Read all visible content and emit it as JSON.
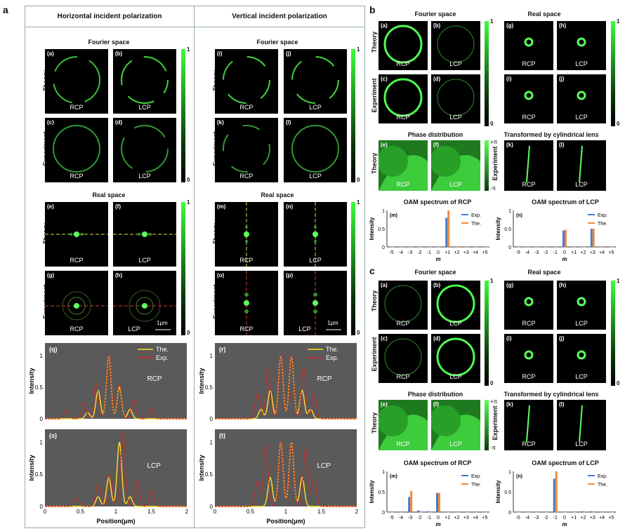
{
  "panel_letters": {
    "a": "a",
    "b": "b",
    "c": "c"
  },
  "a": {
    "left_header": "Horizontal incident polarization",
    "right_header": "Vertical incident polarization",
    "fourier": "Fourier space",
    "real": "Real space",
    "theory": "Theory",
    "experiment": "Experiment",
    "cbar_top": "1",
    "cbar_bot": "0",
    "scale": "1μm",
    "tiles_left": [
      {
        "t": "(a)",
        "b": "RCP"
      },
      {
        "t": "(b)",
        "b": "LCP"
      },
      {
        "t": "(c)",
        "b": "RCP"
      },
      {
        "t": "(d)",
        "b": "LCP"
      },
      {
        "t": "(e)",
        "b": "RCP"
      },
      {
        "t": "(f)",
        "b": "LCP"
      },
      {
        "t": "(g)",
        "b": "RCP"
      },
      {
        "t": "(h)",
        "b": "LCP"
      }
    ],
    "tiles_right": [
      {
        "t": "(i)",
        "b": "RCP"
      },
      {
        "t": "(j)",
        "b": "LCP"
      },
      {
        "t": "(k)",
        "b": "RCP"
      },
      {
        "t": "(l)",
        "b": "LCP"
      },
      {
        "t": "(m)",
        "b": "RCP"
      },
      {
        "t": "(n)",
        "b": "LCP"
      },
      {
        "t": "(o)",
        "b": "RCP"
      },
      {
        "t": "(p)",
        "b": "LCP"
      }
    ],
    "xlabel": "Position(μm)",
    "ylabel": "Intensity",
    "legend_the": "The.",
    "legend_exp": "Exp."
  },
  "b": {
    "fourier": "Fourier space",
    "real": "Real space",
    "phase": "Phase distribution",
    "transformed": "Transformed  by cylindrical lens",
    "theory": "Theory",
    "experiment": "Experiment",
    "tiles": [
      {
        "t": "(a)",
        "b": "RCP"
      },
      {
        "t": "(b)",
        "b": "LCP"
      },
      {
        "t": "(g)",
        "b": "RCP"
      },
      {
        "t": "(h)",
        "b": "LCP"
      },
      {
        "t": "(c)",
        "b": "RCP"
      },
      {
        "t": "(d)",
        "b": "LCP"
      },
      {
        "t": "(i)",
        "b": "RCP"
      },
      {
        "t": "(j)",
        "b": "LCP"
      },
      {
        "t": "(e)",
        "b": "RCP"
      },
      {
        "t": "(f)",
        "b": "LCP"
      },
      {
        "t": "(k)",
        "b": "RCP"
      },
      {
        "t": "(l)",
        "b": "LCP"
      }
    ],
    "pi_top": "+π",
    "pi_bot": "-π",
    "oam_rcp": "OAM spectrum of RCP",
    "oam_lcp": "OAM spectrum of LCP",
    "m_label": "m"
  },
  "c": {
    "fourier": "Fourier space",
    "real": "Real space",
    "phase": "Phase distribution",
    "transformed": "Transformed  by cylindrical lens",
    "theory": "Theory",
    "experiment": "Experiment",
    "tiles": [
      {
        "t": "(a)",
        "b": "RCP"
      },
      {
        "t": "(b)",
        "b": "LCP"
      },
      {
        "t": "(g)",
        "b": "RCP"
      },
      {
        "t": "(h)",
        "b": "LCP"
      },
      {
        "t": "(c)",
        "b": "RCP"
      },
      {
        "t": "(d)",
        "b": "LCP"
      },
      {
        "t": "(i)",
        "b": "RCP"
      },
      {
        "t": "(j)",
        "b": "LCP"
      },
      {
        "t": "(e)",
        "b": "RCP"
      },
      {
        "t": "(f)",
        "b": "LCP"
      },
      {
        "t": "(k)",
        "b": "RCP"
      },
      {
        "t": "(l)",
        "b": "LCP"
      }
    ],
    "oam_rcp": "OAM spectrum of RCP",
    "oam_lcp": "OAM spectrum of LCP"
  },
  "chart_data": [
    {
      "type": "line",
      "id": "q",
      "label": "(q)",
      "annotation": "RCP",
      "xlim": [
        0,
        2
      ],
      "ylim": [
        0,
        1.2
      ],
      "xticks": [
        "0",
        "0.5",
        "1",
        "1.5",
        "2"
      ],
      "yticks": [
        "0",
        "0.5",
        "1"
      ],
      "series": [
        {
          "name": "The.",
          "color": "#ffe02a",
          "peaks": [
            [
              0.9,
              1.0
            ],
            [
              1.05,
              0.5
            ],
            [
              0.75,
              0.45
            ],
            [
              1.2,
              0.15
            ],
            [
              0.6,
              0.1
            ]
          ]
        },
        {
          "name": "Exp.",
          "color": "#d42a2a",
          "peaks": [
            [
              0.9,
              1.0
            ],
            [
              1.05,
              0.55
            ],
            [
              0.72,
              0.55
            ],
            [
              1.25,
              0.3
            ],
            [
              0.55,
              0.25
            ],
            [
              0.3,
              0.15
            ],
            [
              1.5,
              0.15
            ]
          ]
        }
      ]
    },
    {
      "type": "line",
      "id": "r",
      "label": "(r)",
      "annotation": "RCP",
      "xlim": [
        0,
        2
      ],
      "ylim": [
        0,
        1.2
      ],
      "xticks": [
        "0",
        "0.5",
        "1",
        "1.5",
        "2"
      ],
      "yticks": [
        "0",
        "0.5",
        "1"
      ],
      "series": [
        {
          "name": "The.",
          "color": "#ffe02a",
          "peaks": [
            [
              0.93,
              1.0
            ],
            [
              1.08,
              1.0
            ],
            [
              0.78,
              0.45
            ],
            [
              1.23,
              0.45
            ],
            [
              0.65,
              0.15
            ],
            [
              1.35,
              0.15
            ]
          ]
        },
        {
          "name": "Exp.",
          "color": "#d42a2a",
          "peaks": [
            [
              0.93,
              1.0
            ],
            [
              1.08,
              1.0
            ],
            [
              0.75,
              0.8
            ],
            [
              1.25,
              0.8
            ],
            [
              0.6,
              0.4
            ],
            [
              1.4,
              0.4
            ]
          ]
        }
      ]
    },
    {
      "type": "line",
      "id": "s",
      "label": "(s)",
      "annotation": "LCP",
      "xlim": [
        0,
        2
      ],
      "ylim": [
        0,
        1.2
      ],
      "xticks": [
        "0",
        "0.5",
        "1",
        "1.5",
        "2"
      ],
      "yticks": [
        "0",
        "0.5",
        "1"
      ],
      "series": [
        {
          "name": "The.",
          "color": "#ffe02a",
          "peaks": [
            [
              1.05,
              1.0
            ],
            [
              0.9,
              0.45
            ],
            [
              0.75,
              0.15
            ],
            [
              1.2,
              0.15
            ]
          ]
        },
        {
          "name": "Exp.",
          "color": "#d42a2a",
          "peaks": [
            [
              1.1,
              1.15
            ],
            [
              0.92,
              0.5
            ],
            [
              0.75,
              0.35
            ],
            [
              1.3,
              0.4
            ],
            [
              1.5,
              0.25
            ],
            [
              0.45,
              0.15
            ]
          ]
        }
      ]
    },
    {
      "type": "line",
      "id": "t",
      "label": "(t)",
      "annotation": "LCP",
      "xlim": [
        0,
        2
      ],
      "ylim": [
        0,
        1.2
      ],
      "xticks": [
        "0",
        "0.5",
        "1",
        "1.5",
        "2"
      ],
      "yticks": [
        "0",
        "0.5",
        "1"
      ],
      "series": [
        {
          "name": "The.",
          "color": "#ffe02a",
          "peaks": [
            [
              0.93,
              1.0
            ],
            [
              1.08,
              1.0
            ],
            [
              0.78,
              0.45
            ],
            [
              1.23,
              0.45
            ]
          ]
        },
        {
          "name": "Exp.",
          "color": "#d42a2a",
          "peaks": [
            [
              0.93,
              1.0
            ],
            [
              1.08,
              1.0
            ],
            [
              0.72,
              0.95
            ],
            [
              1.28,
              0.9
            ],
            [
              0.6,
              0.4
            ],
            [
              1.4,
              0.4
            ]
          ]
        }
      ]
    },
    {
      "type": "bar",
      "id": "b-m",
      "label": "(m)",
      "title": "OAM spectrum of RCP",
      "xlabel": "m",
      "ylabel": "Intensity",
      "categories": [
        "-5",
        "-4",
        "-3",
        "-2",
        "-1",
        "0",
        "+1",
        "+2",
        "+3",
        "+4",
        "+5"
      ],
      "ylim": [
        0,
        1
      ],
      "yticks": [
        "0",
        "0.5",
        "1"
      ],
      "series": [
        {
          "name": "Exp.",
          "color": "#4a78c8",
          "values": [
            0,
            0,
            0,
            0,
            0,
            0,
            0.8,
            0,
            0,
            0,
            0
          ]
        },
        {
          "name": "The.",
          "color": "#f08a3a",
          "values": [
            0,
            0,
            0,
            0,
            0,
            0,
            1.0,
            0,
            0,
            0,
            0
          ]
        }
      ]
    },
    {
      "type": "bar",
      "id": "b-n",
      "label": "(n)",
      "title": "OAM spectrum of LCP",
      "xlabel": "m",
      "ylabel": "Intensity",
      "categories": [
        "-5",
        "-4",
        "-3",
        "-2",
        "-1",
        "0",
        "+1",
        "+2",
        "+3",
        "+4",
        "+5"
      ],
      "ylim": [
        0,
        1
      ],
      "yticks": [
        "0",
        "0.5",
        "1"
      ],
      "series": [
        {
          "name": "Exp.",
          "color": "#4a78c8",
          "values": [
            0,
            0,
            0,
            0,
            0,
            0.45,
            0,
            0,
            0.5,
            0,
            0
          ]
        },
        {
          "name": "The.",
          "color": "#f08a3a",
          "values": [
            0,
            0,
            0,
            0,
            0,
            0.47,
            0,
            0,
            0.5,
            0,
            0
          ]
        }
      ]
    },
    {
      "type": "bar",
      "id": "c-m",
      "label": "(m)",
      "title": "OAM spectrum of RCP",
      "xlabel": "m",
      "ylabel": "Intensity",
      "categories": [
        "-5",
        "-4",
        "-3",
        "-2",
        "-1",
        "0",
        "+1",
        "+2",
        "+3",
        "+4",
        "+5"
      ],
      "ylim": [
        0,
        1
      ],
      "yticks": [
        "0",
        "0.5",
        "1"
      ],
      "series": [
        {
          "name": "Exp.",
          "color": "#4a78c8",
          "values": [
            0,
            0,
            0.37,
            0.04,
            0.02,
            0.47,
            0,
            0,
            0.01,
            0,
            0
          ]
        },
        {
          "name": "The.",
          "color": "#f08a3a",
          "values": [
            0,
            0,
            0.52,
            0,
            0,
            0.47,
            0,
            0,
            0,
            0,
            0
          ]
        }
      ]
    },
    {
      "type": "bar",
      "id": "c-n",
      "label": "(n)",
      "title": "OAM spectrum of LCP",
      "xlabel": "m",
      "ylabel": "Intensity",
      "categories": [
        "-5",
        "-4",
        "-3",
        "-2",
        "-1",
        "0",
        "+1",
        "+2",
        "+3",
        "+4",
        "+5"
      ],
      "ylim": [
        0,
        1
      ],
      "yticks": [
        "0",
        "0.5",
        "1"
      ],
      "series": [
        {
          "name": "Exp.",
          "color": "#4a78c8",
          "values": [
            0,
            0,
            0,
            0,
            0.82,
            0,
            0,
            0.02,
            0.02,
            0,
            0
          ]
        },
        {
          "name": "The.",
          "color": "#f08a3a",
          "values": [
            0,
            0,
            0,
            0,
            1.0,
            0,
            0,
            0,
            0,
            0,
            0
          ]
        }
      ]
    }
  ]
}
